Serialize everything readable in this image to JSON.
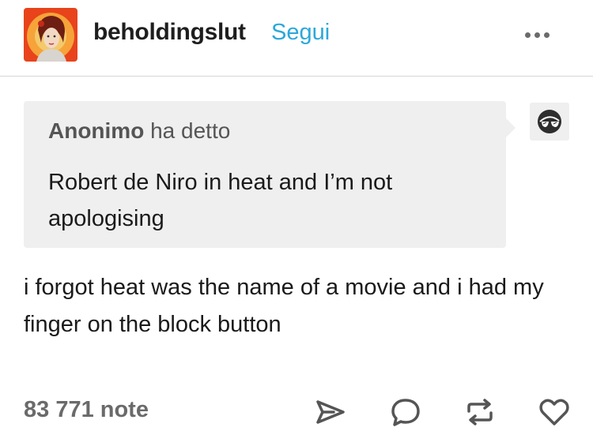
{
  "post": {
    "author": "beholdingslut",
    "follow_label": "Segui",
    "asker_name": "Anonimo",
    "asker_suffix": " ha detto",
    "question": "Robert de Niro in heat and I’m not apologising",
    "answer": "i forgot heat was the name of a movie and i had my finger on the block button",
    "notes_count": "83 771 note"
  },
  "icons": {
    "avatar": "avatar",
    "more": "more-dots-icon",
    "anon": "anonymous-sunglasses-icon",
    "share": "share-arrow-icon",
    "reply": "reply-bubble-icon",
    "reblog": "reblog-icon",
    "like": "heart-icon"
  },
  "colors": {
    "follow": "#2ba8d9",
    "ask_bg": "#efefef",
    "icon": "#555555"
  }
}
